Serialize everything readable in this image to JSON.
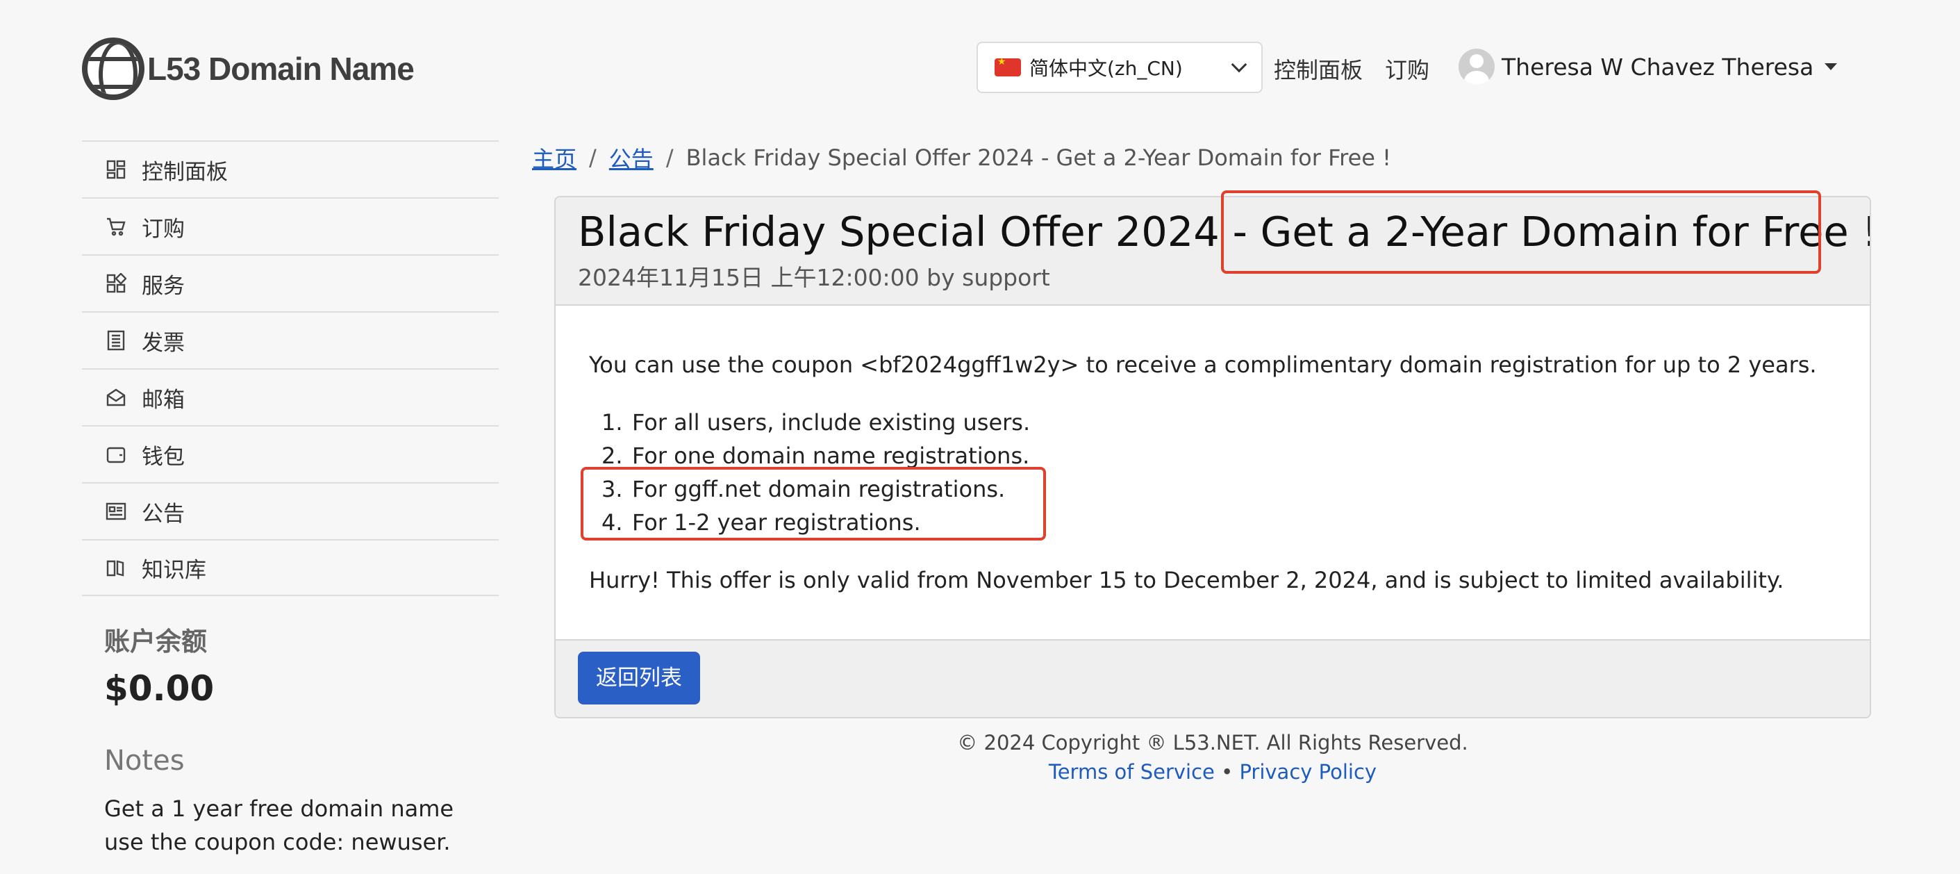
{
  "header": {
    "logo_text": "L53 Domain Name",
    "language": "简体中文(zh_CN)",
    "nav_links": [
      "控制面板",
      "订购"
    ],
    "user_name": "Theresa W Chavez Theresa"
  },
  "sidebar": {
    "items": [
      {
        "label": "控制面板",
        "icon": "dashboard-icon"
      },
      {
        "label": "订购",
        "icon": "cart-icon"
      },
      {
        "label": "服务",
        "icon": "services-icon"
      },
      {
        "label": "发票",
        "icon": "invoice-icon"
      },
      {
        "label": "邮箱",
        "icon": "mail-icon"
      },
      {
        "label": "钱包",
        "icon": "wallet-icon"
      },
      {
        "label": "公告",
        "icon": "announcement-icon"
      },
      {
        "label": "知识库",
        "icon": "knowledgebase-icon"
      }
    ],
    "balance_title": "账户余额",
    "balance_value": "$0.00",
    "notes_title": "Notes",
    "notes_text": "Get a 1 year free domain name use the coupon code: newuser."
  },
  "breadcrumb": {
    "home": "主页",
    "sep1": "/",
    "announcements": "公告",
    "sep2": "/",
    "current": "Black Friday Special Offer 2024 - Get a 2-Year Domain for Free !"
  },
  "article": {
    "title": "Black Friday Special Offer 2024 - Get a 2-Year Domain for Free !",
    "meta": "2024年11月15日 上午12:00:00 by support",
    "intro": "You can use the coupon <bf2024ggff1w2y> to receive a complimentary domain registration for up to 2 years.",
    "list": [
      {
        "num": "1.",
        "text": "For all users, include existing users."
      },
      {
        "num": "2.",
        "text": "For one domain name registrations."
      },
      {
        "num": "3.",
        "text": "For ggff.net domain registrations."
      },
      {
        "num": "4.",
        "text": "For 1-2 year registrations."
      }
    ],
    "outro": "Hurry! This offer is only valid from November 15 to December 2, 2024, and is subject to limited availability.",
    "back_button": "返回列表"
  },
  "footer": {
    "copyright": "© 2024 Copyright ® L53.NET. All Rights Reserved.",
    "terms": "Terms of Service",
    "separator": "•",
    "privacy": "Privacy Policy"
  },
  "colors": {
    "accent": "#2a5fc5",
    "link": "#1d5bbf",
    "highlight": "#e0402e"
  }
}
